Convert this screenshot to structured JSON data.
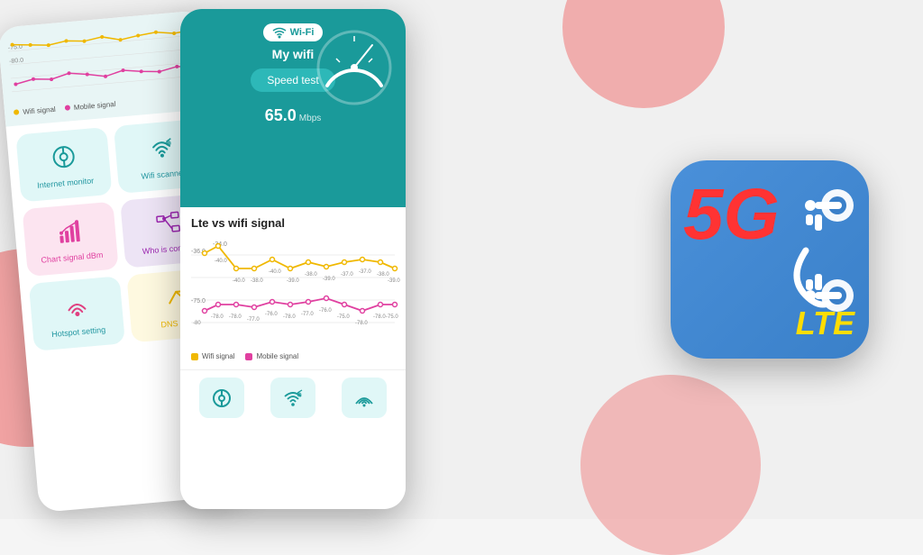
{
  "background": {
    "color": "#f0f0f0",
    "shape_color": "#f08080"
  },
  "phone_left": {
    "chart_legend": {
      "wifi": "Wifi signal",
      "mobile": "Mobile signal"
    },
    "apps": [
      {
        "id": "internet-monitor",
        "label": "Internet monitor",
        "color": "green",
        "icon": "⊙"
      },
      {
        "id": "wifi-scanner",
        "label": "Wifi scanner",
        "color": "green",
        "icon": "📡"
      },
      {
        "id": "chart-signal",
        "label": "Chart signal dBm",
        "color": "pink",
        "icon": "📊"
      },
      {
        "id": "who-connected",
        "label": "Who is connect",
        "color": "purple",
        "icon": "🖧"
      },
      {
        "id": "hotspot-setting",
        "label": "Hotspot setting",
        "color": "green",
        "icon": "📶"
      },
      {
        "id": "dns-ip",
        "label": "DNS - Ip",
        "color": "yellow",
        "icon": "↗"
      }
    ]
  },
  "phone_center": {
    "header": {
      "wifi_badge": "Wi-Fi",
      "network_name": "My wifi",
      "speed_test_btn": "Speed test",
      "speed_value": "65.0",
      "speed_unit": "Mbps"
    },
    "chart_section": {
      "title": "Lte vs wifi signal",
      "wifi_data": [
        -36,
        -34,
        -40,
        -40,
        -38,
        -40,
        -39,
        -38,
        -39,
        -38,
        -37,
        -37,
        -38,
        -39
      ],
      "mobile_data": [
        -80,
        -78,
        -78,
        -77,
        -76,
        -78,
        -77,
        -76,
        -75,
        -78,
        -78,
        -75
      ],
      "legend": {
        "wifi": "Wifi signal",
        "mobile": "Mobile signal"
      }
    },
    "bottom_icons": [
      "⊙",
      "📡",
      "📶"
    ]
  },
  "app_icon_5g": {
    "large_text": "5G",
    "lte_text": "LTE"
  }
}
